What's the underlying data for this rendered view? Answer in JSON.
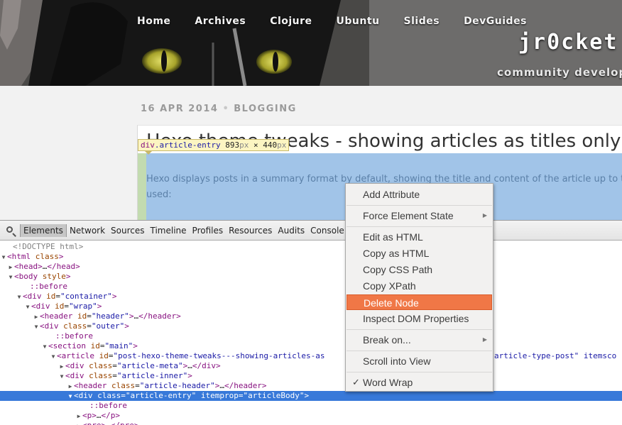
{
  "site": {
    "nav": [
      "Home",
      "Archives",
      "Clojure",
      "Ubuntu",
      "Slides",
      "DevGuides"
    ],
    "brand": "jr0cket",
    "tagline": "community develope",
    "meta": {
      "date": "16 APR 2014",
      "sep": "•",
      "category": "BLOGGING"
    },
    "article_title": "Hexo themes tweaks - showing articles as titles only",
    "article_title_visible": "Hexo theme tweaks - showing articles as titles only",
    "article_text_line1": "Hexo displays posts in a summary format by default, showing the title and content of the article up to the p",
    "article_text_line2": "used:"
  },
  "tooltip": {
    "tag": "div",
    "cls": ".article-entry",
    "w": "893",
    "px1": "px",
    "x": " × ",
    "h": "440",
    "px2": "px"
  },
  "devtools": {
    "tabs": [
      "Elements",
      "Network",
      "Sources",
      "Timeline",
      "Profiles",
      "Resources",
      "Audits",
      "Console"
    ],
    "active_tab": "Elements",
    "tree": [
      {
        "tri": "",
        "ind": 18,
        "html": "<span class='c'>&lt;!DOCTYPE html&gt;</span>"
      },
      {
        "tri": "▼",
        "ind": 8,
        "html": "<span class='t'>&lt;html</span> <span class='a'>class</span><span class='t'>&gt;</span>"
      },
      {
        "tri": "▶",
        "ind": 20,
        "html": "<span class='t'>&lt;head&gt;</span>…<span class='t'>&lt;/head&gt;</span>"
      },
      {
        "tri": "▼",
        "ind": 20,
        "html": "<span class='t'>&lt;body</span> <span class='a'>style</span><span class='t'>&gt;</span>"
      },
      {
        "tri": "",
        "ind": 42,
        "html": "<span class='p'>::before</span>"
      },
      {
        "tri": "▼",
        "ind": 32,
        "html": "<span class='t'>&lt;div</span> <span class='a'>id</span>=<span class='v'>\"container\"</span><span class='t'>&gt;</span>"
      },
      {
        "tri": "▼",
        "ind": 44,
        "html": "<span class='t'>&lt;div</span> <span class='a'>id</span>=<span class='v'>\"wrap\"</span><span class='t'>&gt;</span>"
      },
      {
        "tri": "▶",
        "ind": 56,
        "html": "<span class='t'>&lt;header</span> <span class='a'>id</span>=<span class='v'>\"header\"</span><span class='t'>&gt;</span>…<span class='t'>&lt;/header&gt;</span>"
      },
      {
        "tri": "▼",
        "ind": 56,
        "html": "<span class='t'>&lt;div</span> <span class='a'>class</span>=<span class='v'>\"outer\"</span><span class='t'>&gt;</span>"
      },
      {
        "tri": "",
        "ind": 78,
        "html": "<span class='p'>::before</span>"
      },
      {
        "tri": "▼",
        "ind": 68,
        "html": "<span class='t'>&lt;section</span> <span class='a'>id</span>=<span class='v'>\"main\"</span><span class='t'>&gt;</span>"
      },
      {
        "tri": "▼",
        "ind": 80,
        "html": "<span class='t'>&lt;article</span> <span class='a'>id</span>=<span class='v'>\"post-hexo-theme-tweaks---showing-articles-as</span>"
      },
      {
        "tri": "▶",
        "ind": 92,
        "html": "<span class='t'>&lt;div</span> <span class='a'>class</span>=<span class='v'>\"article-meta\"</span><span class='t'>&gt;</span>…<span class='t'>&lt;/div&gt;</span>"
      },
      {
        "tri": "▼",
        "ind": 92,
        "html": "<span class='t'>&lt;div</span> <span class='a'>class</span>=<span class='v'>\"article-inner\"</span><span class='t'>&gt;</span>"
      },
      {
        "tri": "▶",
        "ind": 104,
        "html": "<span class='t'>&lt;header</span> <span class='a'>class</span>=<span class='v'>\"article-header\"</span><span class='t'>&gt;</span>…<span class='t'>&lt;/header&gt;</span>"
      },
      {
        "tri": "▼",
        "ind": 104,
        "sel": true,
        "html": "<span class='t'>&lt;div</span> <span class='a'>class</span>=<span class='v'>\"article-entry\"</span> <span class='a'>itemprop</span>=<span class='v'>\"articleBody\"</span><span class='t'>&gt;</span>"
      },
      {
        "tri": "",
        "ind": 126,
        "html": "<span class='p'>::before</span>"
      },
      {
        "tri": "▶",
        "ind": 116,
        "html": "<span class='t'>&lt;p&gt;</span>…<span class='t'>&lt;/p&gt;</span>"
      },
      {
        "tri": "▶",
        "ind": 116,
        "html": "<span class='t'>&lt;pre&gt;</span>…<span class='t'>&lt;/pre&gt;</span>"
      }
    ],
    "article_tail": "article-type-post\" itemsco"
  },
  "context_menu": {
    "items": [
      {
        "label": "Add Attribute"
      },
      {
        "sep": true
      },
      {
        "label": "Force Element State",
        "sub": true
      },
      {
        "sep": true
      },
      {
        "label": "Edit as HTML"
      },
      {
        "label": "Copy as HTML"
      },
      {
        "label": "Copy CSS Path"
      },
      {
        "label": "Copy XPath"
      },
      {
        "label": "Delete Node",
        "hl": true
      },
      {
        "label": "Inspect DOM Properties"
      },
      {
        "sep": true
      },
      {
        "label": "Break on...",
        "sub": true
      },
      {
        "sep": true
      },
      {
        "label": "Scroll into View"
      },
      {
        "sep": true
      },
      {
        "label": "Word Wrap",
        "check": true
      }
    ]
  },
  "colors": {
    "highlight": "#a1c4e8",
    "selected_row": "#3879d9",
    "menu_highlight": "#f07746"
  }
}
